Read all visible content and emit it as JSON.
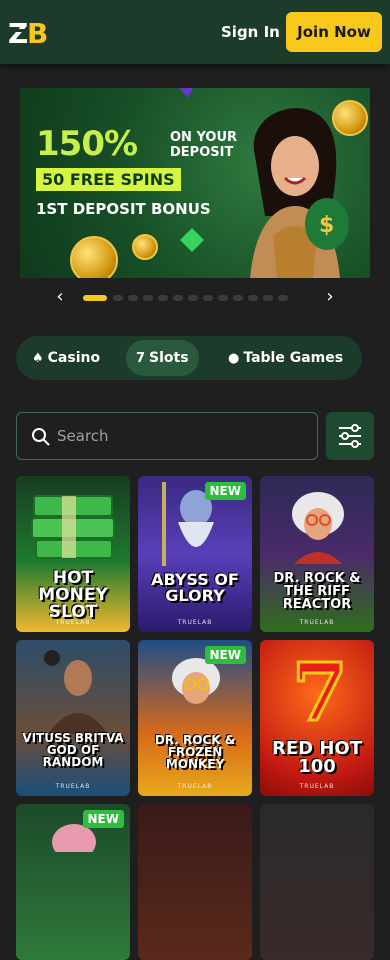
{
  "header": {
    "logo_text": "ZB",
    "signin_label": "Sign In",
    "join_label": "Join Now"
  },
  "banner": {
    "percent": "150%",
    "on_deposit": "ON YOUR DEPOSIT",
    "free_spins": "50 FREE SPINS",
    "bonus": "1ST DEPOSIT BONUS"
  },
  "carousel": {
    "prev": "‹",
    "next": "›",
    "dot_count": 13,
    "active_index": 0
  },
  "tabs": [
    {
      "label": "Casino",
      "icon": "casino-icon"
    },
    {
      "label": "Slots",
      "icon": "seven-icon"
    },
    {
      "label": "Table Games",
      "icon": "chip-icon"
    }
  ],
  "search": {
    "placeholder": "Search"
  },
  "games": [
    {
      "title": "HOT MONEY SLOT",
      "brand": "TRUELAB",
      "badge": ""
    },
    {
      "title": "ABYSS OF GLORY",
      "brand": "TRUELAB",
      "badge": "NEW"
    },
    {
      "title": "DR. ROCK & THE RIFF REACTOR",
      "brand": "TRUELAB",
      "badge": ""
    },
    {
      "title": "VITUSS BRITVA GOD OF RANDOM",
      "brand": "TRUELAB",
      "badge": ""
    },
    {
      "title": "DR. ROCK & FROZEN MONKEY",
      "brand": "TRUELAB",
      "badge": "NEW"
    },
    {
      "title": "RED HOT 100",
      "brand": "TRUELAB",
      "badge": ""
    },
    {
      "title": "",
      "brand": "",
      "badge": "NEW"
    }
  ]
}
